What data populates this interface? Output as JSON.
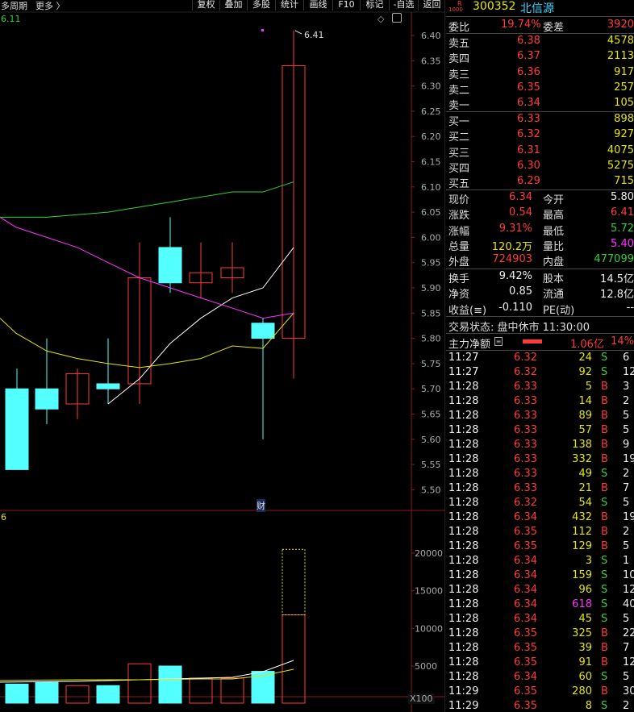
{
  "toolbar": {
    "left_label": "多周期",
    "more_label": "更多 〉",
    "buttons": [
      "复权",
      "叠加",
      "多股",
      "统计",
      "画线",
      "F10",
      "标记",
      "-自选",
      "返回"
    ]
  },
  "chart": {
    "top_left_value": "6.11",
    "high_label": "6.41",
    "price_ticks": [
      "6.40",
      "6.35",
      "6.30",
      "6.25",
      "6.20",
      "6.15",
      "6.10",
      "6.05",
      "6.00",
      "5.95",
      "5.90",
      "5.85",
      "5.80",
      "5.75",
      "5.70",
      "5.65",
      "5.60",
      "5.55",
      "5.50"
    ],
    "finance_marker": "财",
    "vol_top_left": "6",
    "vol_ticks": [
      "20000",
      "15000",
      "10000",
      "5000"
    ],
    "vol_unit": "X100",
    "colors": {
      "up": "#ff3b3b",
      "down": "#54ffff",
      "ma5": "#ffffff",
      "ma10": "#e6e600",
      "ma20": "#ff33ff",
      "ma60": "#34d233"
    }
  },
  "stock": {
    "badge_top": "R",
    "badge_bottom": "1000",
    "code": "300352",
    "name": "北信源"
  },
  "orderbook": {
    "weibi_label": "委比",
    "weibi_value": "19.74%",
    "weicha_label": "委差",
    "weicha_value": "3920",
    "asks": [
      {
        "label": "卖五",
        "price": "6.38",
        "vol": "4578"
      },
      {
        "label": "卖四",
        "price": "6.37",
        "vol": "2113"
      },
      {
        "label": "卖三",
        "price": "6.36",
        "vol": "917"
      },
      {
        "label": "卖二",
        "price": "6.35",
        "vol": "257"
      },
      {
        "label": "卖一",
        "price": "6.34",
        "vol": "105"
      }
    ],
    "bids": [
      {
        "label": "买一",
        "price": "6.33",
        "vol": "898"
      },
      {
        "label": "买二",
        "price": "6.32",
        "vol": "927"
      },
      {
        "label": "买三",
        "price": "6.31",
        "vol": "4075"
      },
      {
        "label": "买四",
        "price": "6.30",
        "vol": "5275"
      },
      {
        "label": "买五",
        "price": "6.29",
        "vol": "715"
      }
    ]
  },
  "quote": {
    "rows": [
      {
        "l1": "现价",
        "v1": "6.34",
        "c1": "red",
        "l2": "今开",
        "v2": "5.80",
        "c2": "wht"
      },
      {
        "l1": "涨跌",
        "v1": "0.54",
        "c1": "red",
        "l2": "最高",
        "v2": "6.41",
        "c2": "red"
      },
      {
        "l1": "涨幅",
        "v1": "9.31%",
        "c1": "red",
        "l2": "最低",
        "v2": "5.72",
        "c2": "grn"
      },
      {
        "l1": "总量",
        "v1": "120.2万",
        "c1": "yel",
        "l2": "量比",
        "v2": "5.40",
        "c2": "mag"
      },
      {
        "l1": "外盘",
        "v1": "724903",
        "c1": "red",
        "l2": "内盘",
        "v2": "477099",
        "c2": "grn"
      }
    ],
    "rows2": [
      {
        "l1": "换手",
        "v1": "9.42%",
        "l2": "股本",
        "v2": "14.5亿"
      },
      {
        "l1": "净资",
        "v1": "0.85",
        "l2": "流通",
        "v2": "12.8亿"
      },
      {
        "l1": "收益(≡)",
        "v1": "-0.110",
        "l2": "PE(动)",
        "v2": "--"
      }
    ],
    "trade_status": "交易状态: 盘中休市 11:30:00",
    "main_flow_label": "主力净额",
    "main_flow_value": "1.06亿",
    "main_flow_pct": "14%"
  },
  "ticks": [
    {
      "t": "11:27",
      "p": "6.32",
      "v": "24",
      "s": "S",
      "n": "6"
    },
    {
      "t": "11:27",
      "p": "6.32",
      "v": "92",
      "s": "S",
      "n": "12"
    },
    {
      "t": "11:28",
      "p": "6.33",
      "v": "5",
      "s": "B",
      "n": "3"
    },
    {
      "t": "11:28",
      "p": "6.33",
      "v": "14",
      "s": "B",
      "n": "2"
    },
    {
      "t": "11:28",
      "p": "6.33",
      "v": "89",
      "s": "B",
      "n": "5"
    },
    {
      "t": "11:28",
      "p": "6.33",
      "v": "57",
      "s": "B",
      "n": "5"
    },
    {
      "t": "11:28",
      "p": "6.33",
      "v": "138",
      "s": "B",
      "n": "9"
    },
    {
      "t": "11:28",
      "p": "6.33",
      "v": "332",
      "s": "B",
      "n": "19"
    },
    {
      "t": "11:28",
      "p": "6.33",
      "v": "49",
      "s": "S",
      "n": "2"
    },
    {
      "t": "11:28",
      "p": "6.33",
      "v": "21",
      "s": "B",
      "n": "7"
    },
    {
      "t": "11:28",
      "p": "6.32",
      "v": "54",
      "s": "S",
      "n": "5"
    },
    {
      "t": "11:28",
      "p": "6.34",
      "v": "432",
      "s": "B",
      "n": "19"
    },
    {
      "t": "11:28",
      "p": "6.35",
      "v": "112",
      "s": "B",
      "n": "2"
    },
    {
      "t": "11:28",
      "p": "6.35",
      "v": "129",
      "s": "B",
      "n": "5"
    },
    {
      "t": "11:28",
      "p": "6.34",
      "v": "3",
      "s": "S",
      "n": "1"
    },
    {
      "t": "11:28",
      "p": "6.34",
      "v": "159",
      "s": "S",
      "n": "10"
    },
    {
      "t": "11:28",
      "p": "6.34",
      "v": "96",
      "s": "S",
      "n": "12"
    },
    {
      "t": "11:28",
      "p": "6.34",
      "v": "618",
      "s": "S",
      "n": "40",
      "vc": "mag"
    },
    {
      "t": "11:28",
      "p": "6.34",
      "v": "45",
      "s": "S",
      "n": "5"
    },
    {
      "t": "11:28",
      "p": "6.35",
      "v": "325",
      "s": "B",
      "n": "22"
    },
    {
      "t": "11:28",
      "p": "6.35",
      "v": "39",
      "s": "B",
      "n": "7"
    },
    {
      "t": "11:28",
      "p": "6.35",
      "v": "91",
      "s": "B",
      "n": "12"
    },
    {
      "t": "11:28",
      "p": "6.34",
      "v": "60",
      "s": "S",
      "n": "5"
    },
    {
      "t": "11:29",
      "p": "6.35",
      "v": "280",
      "s": "B",
      "n": "30"
    },
    {
      "t": "11:29",
      "p": "6.35",
      "v": "8",
      "s": "S",
      "n": "2"
    }
  ]
}
